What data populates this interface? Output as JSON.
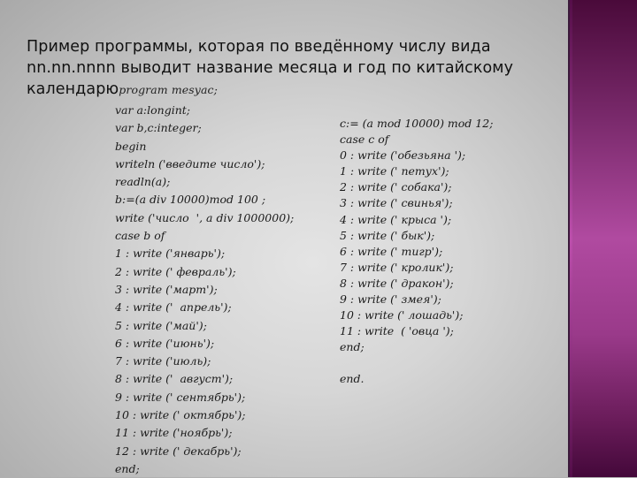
{
  "slide": {
    "title_lines": [
      "Пример программы, которая по введённому числу вида",
      "nn.nn.nnnn выводит название месяца и год по китайскому",
      "календарю"
    ],
    "title_inline_code": "program mesyac;"
  },
  "code_left": [
    "var a:longint;",
    "var b,c:integer;",
    "begin",
    "writeln ('введите число');",
    "readln(a);",
    "b:=(a div 10000)mod 100 ;",
    "write ('число  ', a div 1000000);",
    "case b of",
    "1 : write ('январь');",
    "2 : write (' февраль');",
    "3 : write ('март');",
    "4 : write ('  апрель');",
    "5 : write ('май');",
    "6 : write ('июнь');",
    "7 : write ('июль);",
    "8 : write ('  август');",
    "9 : write (' сентябрь');",
    "10 : write (' октябрь');",
    "11 : write ('ноябрь');",
    "12 : write (' декабрь');",
    "end;"
  ],
  "code_right": [
    "c:= (a mod 10000) mod 12;",
    "case c of",
    "0 : write ('обезьяна ');",
    "1 : write (' петух');",
    "2 : write (' собака');",
    "3 : write (' свинья');",
    "4 : write (' крыса ');",
    "5 : write (' бык');",
    "6 : write (' тигр');",
    "7 : write (' кролик');",
    "8 : write (' дракон');",
    "9 : write (' змея');",
    "10 : write (' лошадь');",
    "11 : write  ( 'овца ');",
    "end;"
  ],
  "code_right_final": "end.",
  "colors": {
    "slide_background": "#d6d6d6",
    "accent_band": "#b04aa0",
    "text": "#111111"
  }
}
